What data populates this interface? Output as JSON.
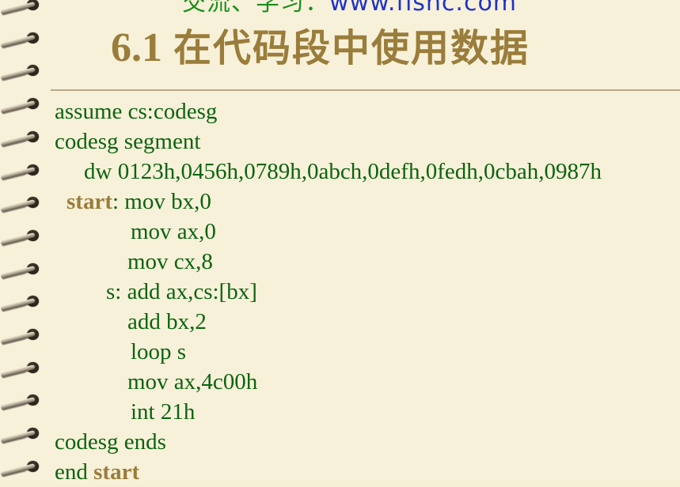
{
  "banner": {
    "chinese": "交流、学习：",
    "url": "www.fishc.com"
  },
  "title": {
    "number": "6.1",
    "text": "在代码段中使用数据"
  },
  "code": {
    "line1": "assume cs:codesg",
    "line2": "codesg segment",
    "line3": "dw 0123h,0456h,0789h,0abch,0defh,0fedh,0cbah,0987h",
    "line4_label": "start",
    "line4_rest": ": mov bx,0",
    "line5": "mov ax,0",
    "line6": "mov cx,8",
    "line7": "s: add ax,cs:[bx]",
    "line8": "add bx,2",
    "line9": "loop s",
    "line10": "mov ax,4c00h",
    "line11": "int 21h",
    "line12": "codesg ends",
    "line13_prefix": "end ",
    "line13_label": "start"
  },
  "colors": {
    "background": "#f8f1d9",
    "code": "#0b6410",
    "title": "#9a7d3b",
    "banner_green": "#1a8f1a",
    "banner_blue": "#1f33c9"
  }
}
